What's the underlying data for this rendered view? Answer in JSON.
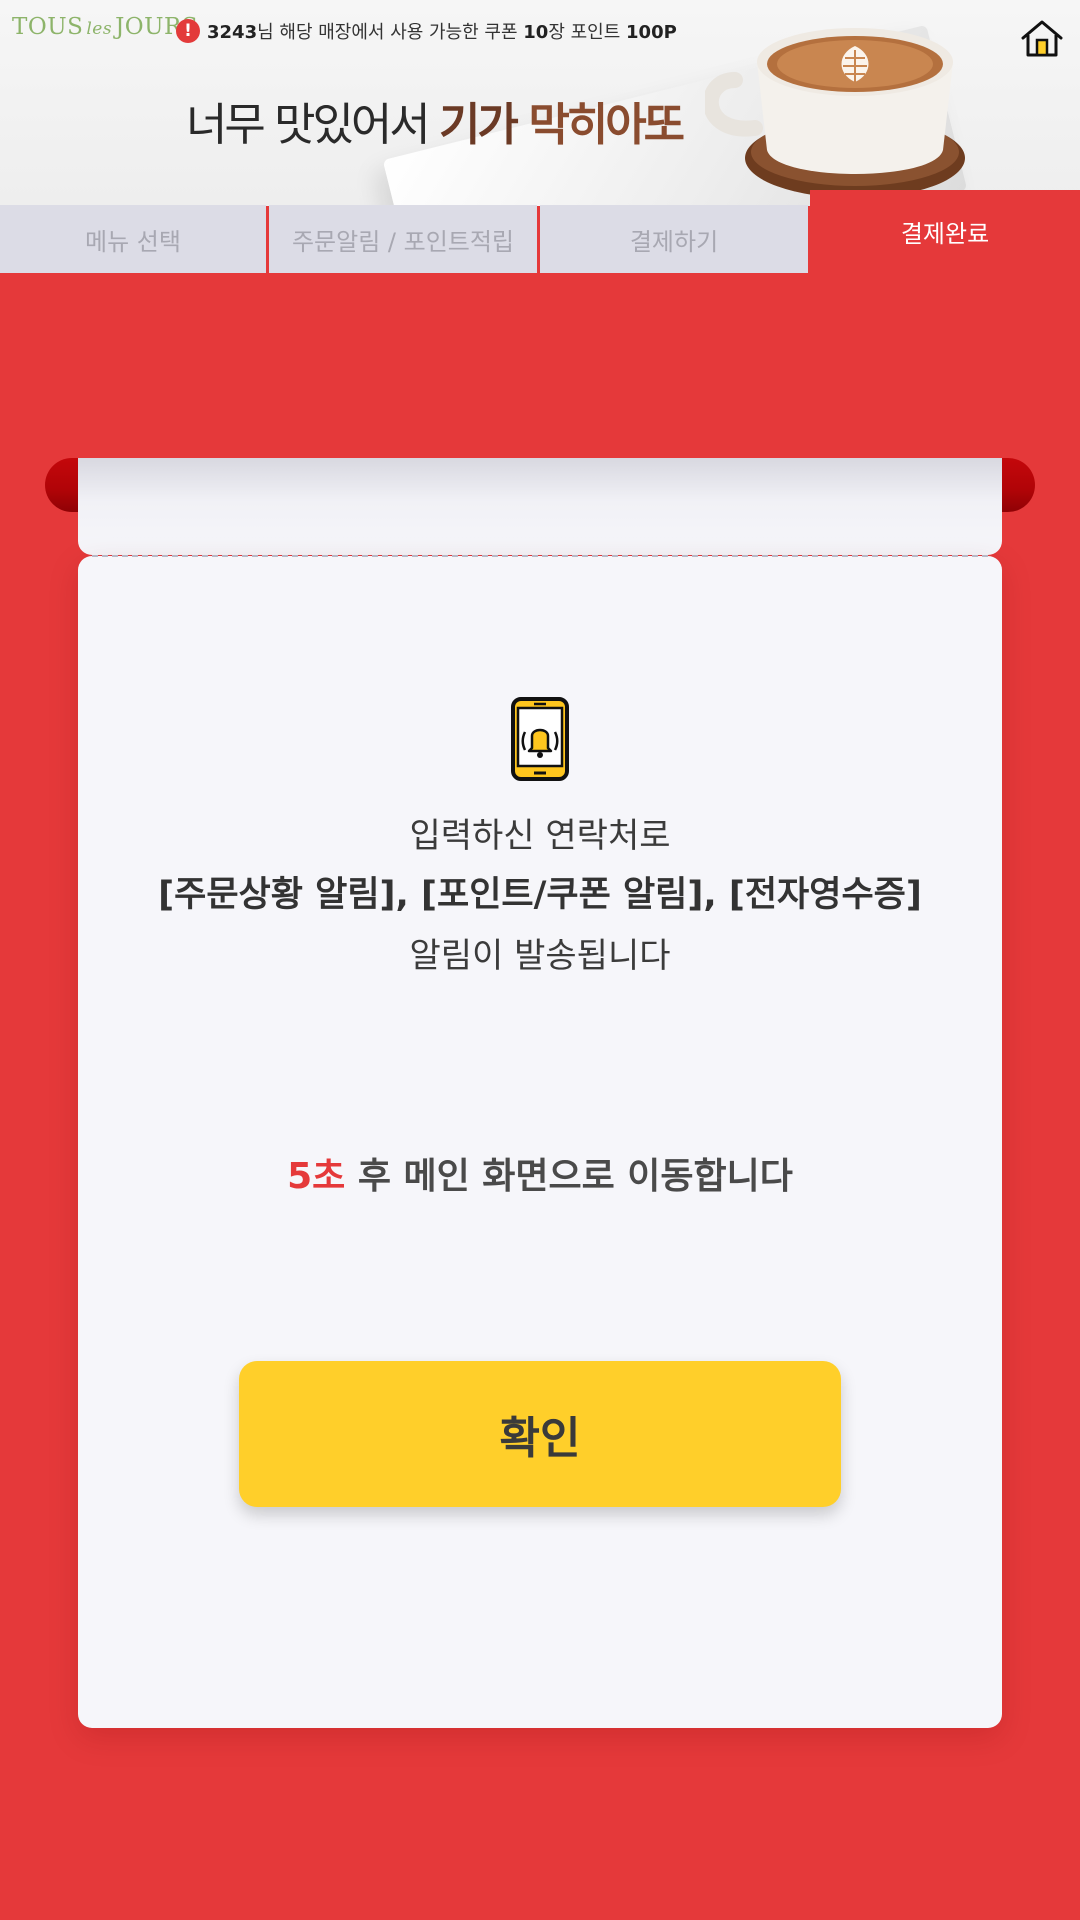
{
  "header": {
    "logo": {
      "part1": "TOUS",
      "part2": "les",
      "part3": "JOURS"
    },
    "notice": {
      "member_id": "3243",
      "text_a": "님 해당 매장에서 사용 가능한 쿠폰 ",
      "coupon_count": "10",
      "text_b": "장 포인트 ",
      "points": "100P"
    },
    "banner": {
      "slogan_plain": "너무 맛있어서 ",
      "slogan_emph1": "기가 ",
      "slogan_emph2": "막히아또"
    },
    "home_icon": "home-icon"
  },
  "tabs": [
    {
      "label": "메뉴 선택",
      "active": false
    },
    {
      "label": "주문알림 / 포인트적립",
      "active": false
    },
    {
      "label": "결제하기",
      "active": false
    },
    {
      "label": "결제완료",
      "active": true
    }
  ],
  "receipt": {
    "icon": "phone-bell-icon",
    "line1": "입력하신 연락처로",
    "line2": "[주문상황 알림], [포인트/쿠폰 알림], [전자영수증]",
    "line3": "알림이 발송됩니다",
    "countdown": {
      "seconds": "5초",
      "rest": " 후 메인 화면으로 이동합니다"
    },
    "confirm_label": "확인"
  },
  "colors": {
    "primary_red": "#e5393a",
    "button_yellow": "#ffcf2a",
    "tab_inactive": "#dcdce6"
  }
}
